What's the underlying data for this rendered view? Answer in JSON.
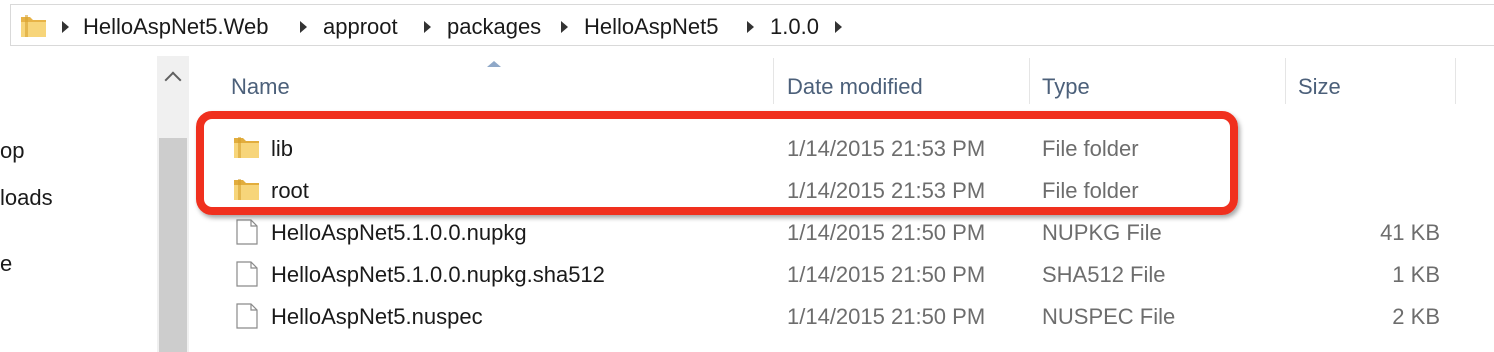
{
  "address_bar": {
    "crumbs": [
      "HelloAspNet5.Web",
      "approot",
      "packages",
      "HelloAspNet5",
      "1.0.0"
    ]
  },
  "nav_pane": {
    "items": [
      "op",
      "loads",
      "e"
    ]
  },
  "columns": {
    "name": "Name",
    "date": "Date modified",
    "type": "Type",
    "size": "Size"
  },
  "files": [
    {
      "name": "lib",
      "date": "1/14/2015 21:53 PM",
      "type": "File folder",
      "size": "",
      "icon": "folder-icon"
    },
    {
      "name": "root",
      "date": "1/14/2015 21:53 PM",
      "type": "File folder",
      "size": "",
      "icon": "folder-icon"
    },
    {
      "name": "HelloAspNet5.1.0.0.nupkg",
      "date": "1/14/2015 21:50 PM",
      "type": "NUPKG File",
      "size": "41 KB",
      "icon": "file-icon"
    },
    {
      "name": "HelloAspNet5.1.0.0.nupkg.sha512",
      "date": "1/14/2015 21:50 PM",
      "type": "SHA512 File",
      "size": "1 KB",
      "icon": "file-icon"
    },
    {
      "name": "HelloAspNet5.nuspec",
      "date": "1/14/2015 21:50 PM",
      "type": "NUSPEC File",
      "size": "2 KB",
      "icon": "file-icon"
    }
  ],
  "colors": {
    "highlight": "#f0301e",
    "header_text": "#4c607a",
    "folder": "#f2c55c"
  }
}
